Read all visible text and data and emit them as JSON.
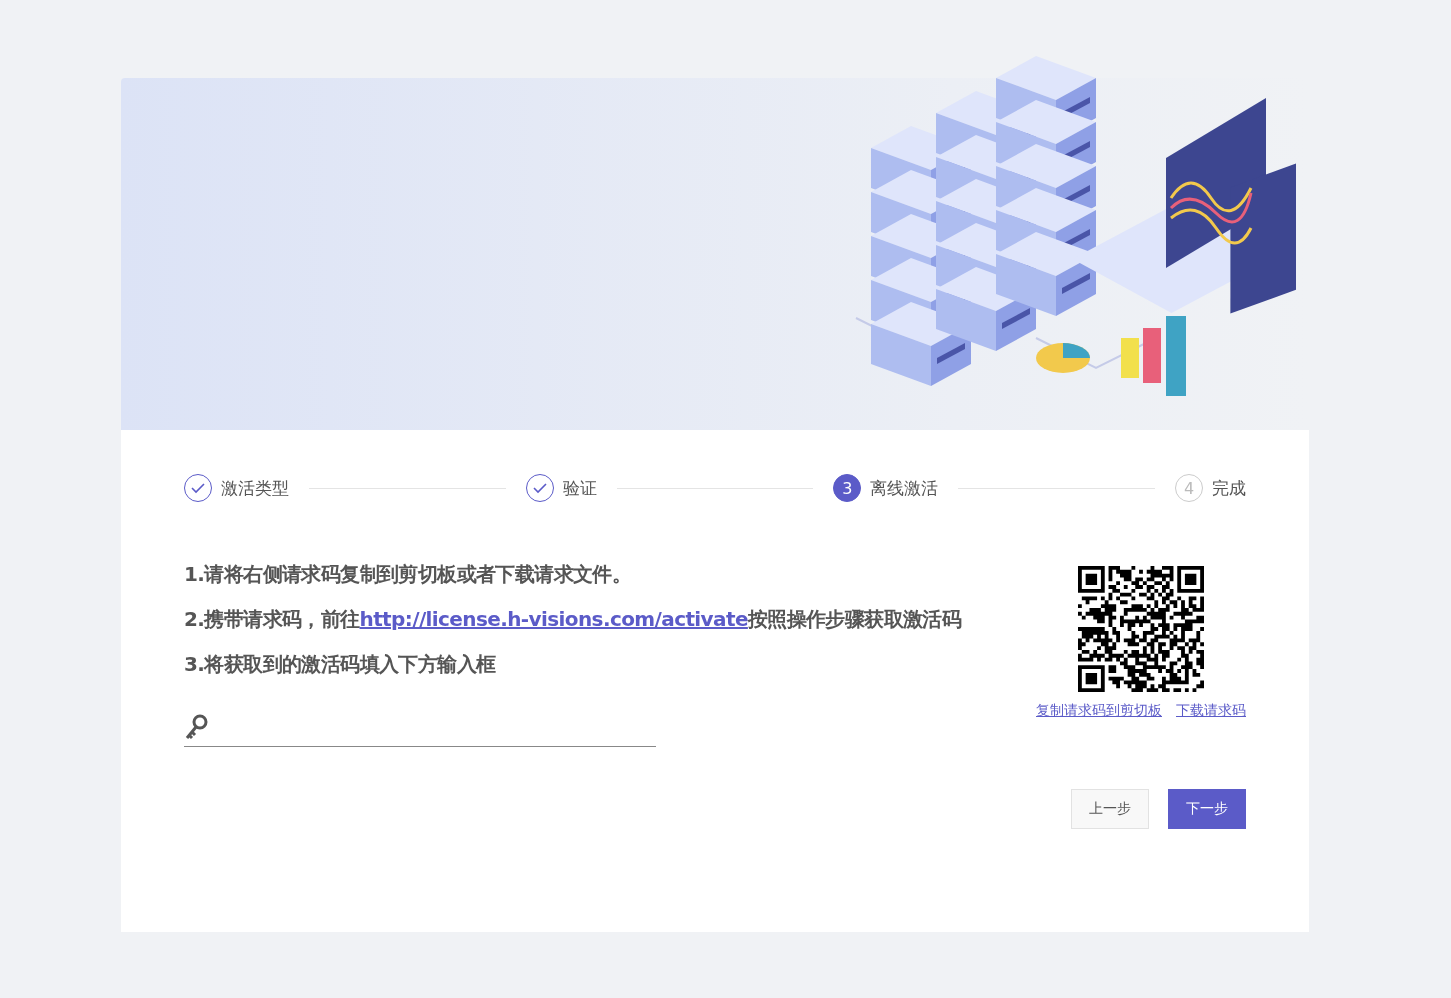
{
  "steps": [
    {
      "kind": "done",
      "label": "激活类型"
    },
    {
      "kind": "done",
      "label": "验证"
    },
    {
      "kind": "current",
      "number": "3",
      "label": "离线激活"
    },
    {
      "kind": "pending",
      "number": "4",
      "label": "完成"
    }
  ],
  "instructions": [
    {
      "text": "1.请将右侧请求码复制到剪切板或者下载请求文件。"
    },
    {
      "text": "2.携带请求码，前往",
      "link": "http://license.h-visions.com/activate",
      "after": "按照操作步骤获取激活码"
    },
    {
      "text": "3.将获取到的激活码填入下方输入框"
    }
  ],
  "request_links": [
    "复制请求码到剪切板",
    "下载请求码"
  ],
  "buttons": [
    {
      "label": "上一步",
      "kind": "secondary"
    },
    {
      "label": "下一步",
      "kind": "primary"
    }
  ]
}
